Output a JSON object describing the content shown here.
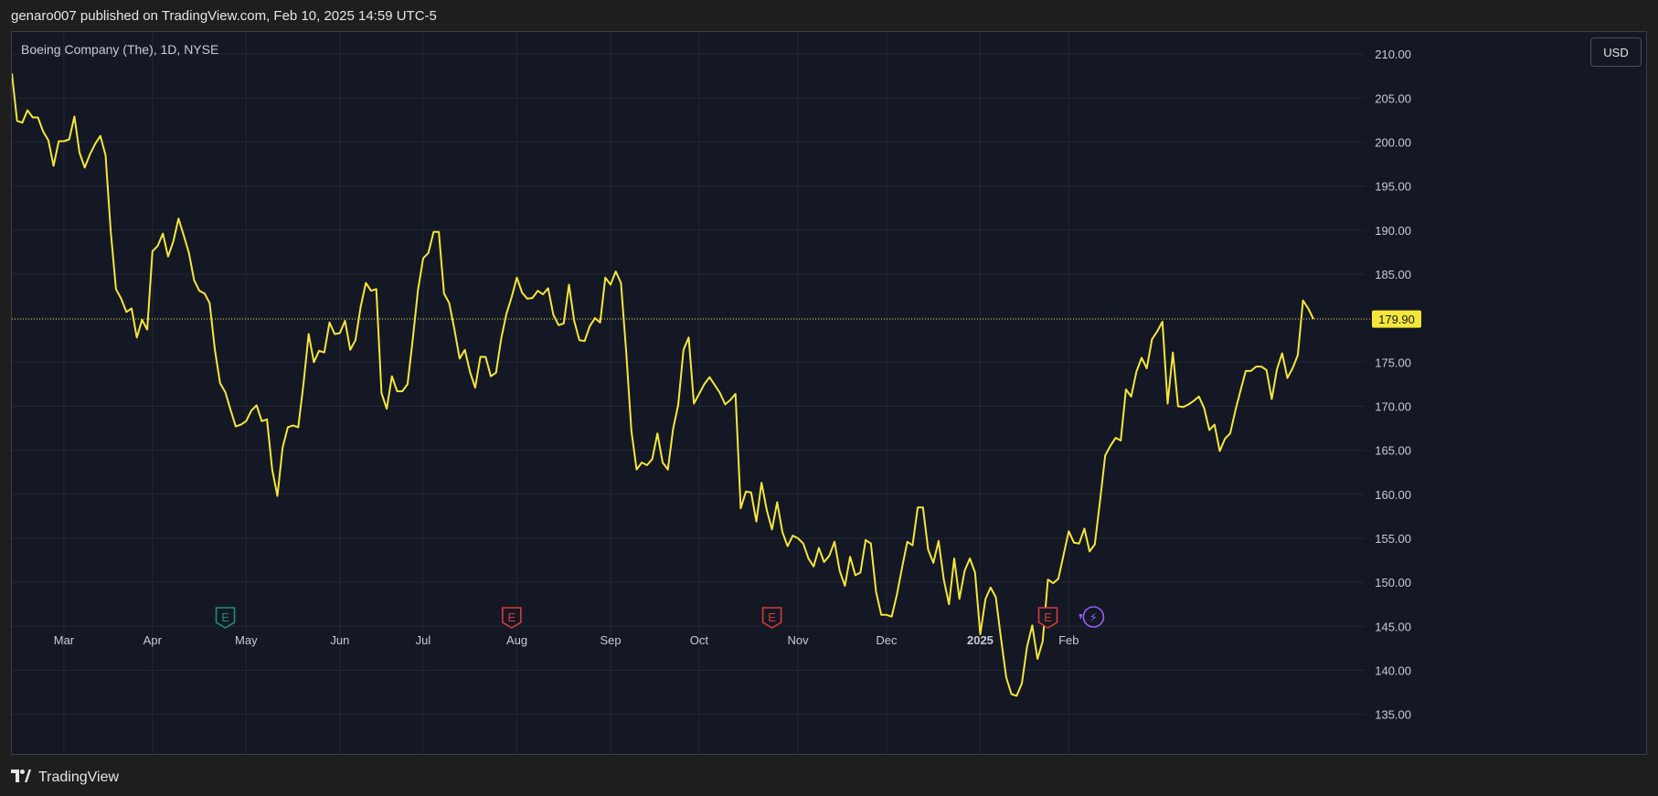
{
  "header": {
    "published_text": "genaro007 published on TradingView.com, Feb 10, 2025 14:59 UTC-5"
  },
  "footer": {
    "brand": "TradingView",
    "logo_icon": "tradingview-logo-icon"
  },
  "colors": {
    "line": "#f5e63b",
    "grid": "#232733",
    "axis_text": "#c8cbd3",
    "price_label_bg": "#f5e63b",
    "earnings_green": "#1e8f6f",
    "earnings_red": "#d63b3b",
    "dividend_purple": "#9c5cf5"
  },
  "chart_data": {
    "type": "line",
    "title": "Boeing Company (The), 1D, NYSE",
    "currency": "USD",
    "last_price": 179.9,
    "last_price_label": "179.90",
    "ylim": [
      130.5,
      212.5
    ],
    "y_ticks": [
      135,
      140,
      145,
      150,
      155,
      160,
      165,
      170,
      175,
      180,
      185,
      190,
      195,
      200,
      205,
      210
    ],
    "y_tick_labels": [
      "135.00",
      "140.00",
      "145.00",
      "150.00",
      "155.00",
      "160.00",
      "165.00",
      "170.00",
      "175.00",
      "180.00",
      "185.00",
      "190.00",
      "195.00",
      "200.00",
      "205.00",
      "210.00"
    ],
    "x_ticks": [
      {
        "label": "Mar",
        "index": 10,
        "bold": false
      },
      {
        "label": "Apr",
        "index": 27,
        "bold": false
      },
      {
        "label": "May",
        "index": 45,
        "bold": false
      },
      {
        "label": "Jun",
        "index": 63,
        "bold": false
      },
      {
        "label": "Jul",
        "index": 79,
        "bold": false
      },
      {
        "label": "Aug",
        "index": 97,
        "bold": false
      },
      {
        "label": "Sep",
        "index": 115,
        "bold": false
      },
      {
        "label": "Oct",
        "index": 132,
        "bold": false
      },
      {
        "label": "Nov",
        "index": 151,
        "bold": false
      },
      {
        "label": "Dec",
        "index": 168,
        "bold": false
      },
      {
        "label": "2025",
        "index": 186,
        "bold": true
      },
      {
        "label": "Feb",
        "index": 203,
        "bold": false
      }
    ],
    "events": [
      {
        "type": "earnings",
        "index": 41,
        "color": "green",
        "label": "E"
      },
      {
        "type": "earnings",
        "index": 96,
        "color": "red",
        "label": "E"
      },
      {
        "type": "earnings",
        "index": 146,
        "color": "red",
        "label": "E"
      },
      {
        "type": "earnings",
        "index": 199,
        "color": "red",
        "label": "E"
      },
      {
        "type": "dividend",
        "index": 206,
        "color": "purple",
        "label": "⚡"
      }
    ],
    "series": [
      {
        "values": [
          207.8,
          202.4,
          202.2,
          203.6,
          202.8,
          202.8,
          201.2,
          200.2,
          197.3,
          200.1,
          200.1,
          200.3,
          202.9,
          198.8,
          197.1,
          198.6,
          199.8,
          200.7,
          198.5,
          189.8,
          183.3,
          182.2,
          180.7,
          181.1,
          177.8,
          179.8,
          178.7,
          187.6,
          188.2,
          189.6,
          187.0,
          188.7,
          191.3,
          189.4,
          187.4,
          184.3,
          183.1,
          182.8,
          181.7,
          176.4,
          172.6,
          171.6,
          169.6,
          167.7,
          167.9,
          168.3,
          169.5,
          170.1,
          168.3,
          168.5,
          162.8,
          159.8,
          165.3,
          167.6,
          167.8,
          167.6,
          172.5,
          178.2,
          175.0,
          176.3,
          176.1,
          179.5,
          178.2,
          178.3,
          179.7,
          176.4,
          177.5,
          181.3,
          184.0,
          183.1,
          183.3,
          171.5,
          169.7,
          173.4,
          171.7,
          171.7,
          172.5,
          177.6,
          183.2,
          186.8,
          187.4,
          189.8,
          189.8,
          182.8,
          181.7,
          178.7,
          175.4,
          176.4,
          173.9,
          172.1,
          175.6,
          175.6,
          173.4,
          173.8,
          177.7,
          180.5,
          182.4,
          184.6,
          182.9,
          182.2,
          182.3,
          183.1,
          182.7,
          183.4,
          180.4,
          179.2,
          179.4,
          183.8,
          179.7,
          177.5,
          177.4,
          179.1,
          180.0,
          179.5,
          184.6,
          183.8,
          185.3,
          184.0,
          176.2,
          167.2,
          162.8,
          163.6,
          163.3,
          164.0,
          166.9,
          163.6,
          162.8,
          167.4,
          170.2,
          176.4,
          177.8,
          170.3,
          171.4,
          172.5,
          173.3,
          172.4,
          171.5,
          170.2,
          170.7,
          171.4,
          158.4,
          160.3,
          160.2,
          156.9,
          161.3,
          158.2,
          156.0,
          159.1,
          155.7,
          154.1,
          155.3,
          155.0,
          154.4,
          152.7,
          151.8,
          153.9,
          152.3,
          153.0,
          154.6,
          151.3,
          149.6,
          152.9,
          150.8,
          151.1,
          154.8,
          154.4,
          148.9,
          146.3,
          146.3,
          146.1,
          148.6,
          151.7,
          154.6,
          154.2,
          158.5,
          158.5,
          153.7,
          152.2,
          154.7,
          150.3,
          147.5,
          152.7,
          148.1,
          151.3,
          152.7,
          151.1,
          144.1,
          148.1,
          149.4,
          148.3,
          143.6,
          139.2,
          137.3,
          137.1,
          138.5,
          142.7,
          145.1,
          141.3,
          143.3,
          150.3,
          149.9,
          150.4,
          153.1,
          155.8,
          154.5,
          154.4,
          156.1,
          153.5,
          154.3,
          159.2,
          164.4,
          165.5,
          166.4,
          166.1,
          171.9,
          171.1,
          173.9,
          175.5,
          174.3,
          177.6,
          178.5,
          179.6,
          170.3,
          176.1,
          170.0,
          169.9,
          170.2,
          170.6,
          171.1,
          169.8,
          167.3,
          167.9,
          164.9,
          166.3,
          166.9,
          169.5,
          171.8,
          174.0,
          174.0,
          174.5,
          174.5,
          174.1,
          170.8,
          174.2,
          176.0,
          173.2,
          174.3,
          175.8,
          182.0,
          181.1,
          179.9
        ]
      }
    ],
    "grid": true,
    "legend": "none"
  }
}
